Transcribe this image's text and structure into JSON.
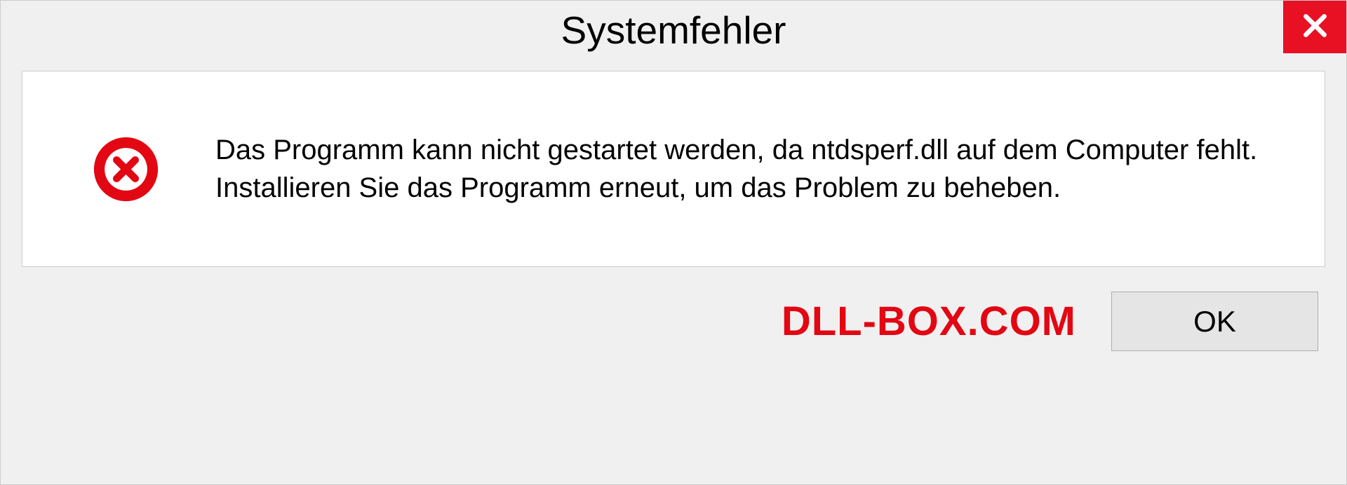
{
  "dialog": {
    "title": "Systemfehler",
    "message": "Das Programm kann nicht gestartet werden, da ntdsperf.dll auf dem Computer fehlt. Installieren Sie das Programm erneut, um das Problem zu beheben.",
    "ok_label": "OK",
    "watermark": "DLL-BOX.COM"
  }
}
